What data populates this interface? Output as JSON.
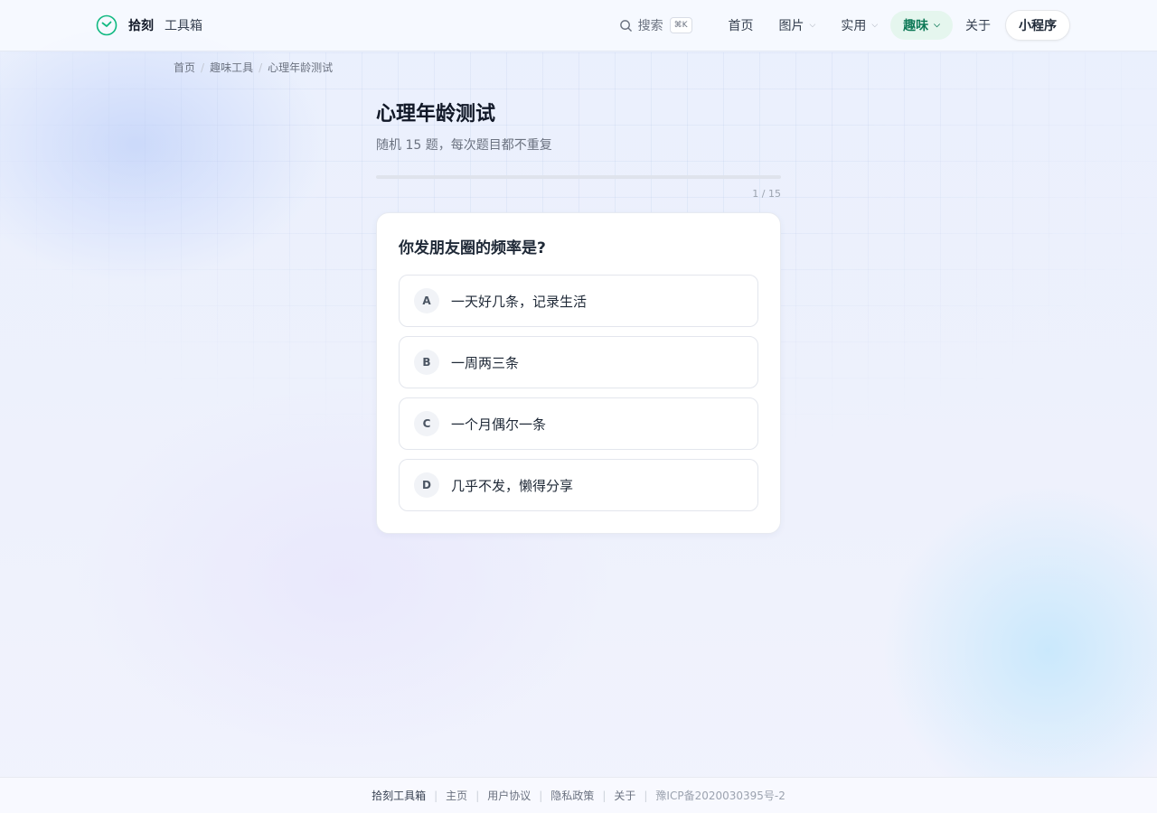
{
  "brand": {
    "name": "拾刻",
    "sub": "工具箱",
    "accent": "#10b981"
  },
  "nav": {
    "search_label": "搜索",
    "search_shortcut": "⌘K",
    "items": [
      {
        "label": "首页"
      },
      {
        "label": "图片"
      },
      {
        "label": "实用"
      },
      {
        "label": "趣味"
      },
      {
        "label": "关于"
      }
    ],
    "mini_program_label": "小程序"
  },
  "breadcrumb": [
    "首页",
    "趣味工具",
    "心理年龄测试"
  ],
  "main": {
    "title": "心理年龄测试",
    "subtitle": "随机 15 题，每次题目都不重复",
    "progress": {
      "current": 1,
      "total": 15,
      "label": "1 / 15"
    },
    "question": "你发朋友圈的频率是?",
    "options": [
      {
        "key": "A",
        "text": "一天好几条，记录生活"
      },
      {
        "key": "B",
        "text": "一周两三条"
      },
      {
        "key": "C",
        "text": "一个月偶尔一条"
      },
      {
        "key": "D",
        "text": "几乎不发，懒得分享"
      }
    ]
  },
  "footer": {
    "brand": "拾刻工具箱",
    "links": [
      "主页",
      "用户协议",
      "隐私政策",
      "关于"
    ],
    "icp": "豫ICP备2020030395号-2"
  }
}
